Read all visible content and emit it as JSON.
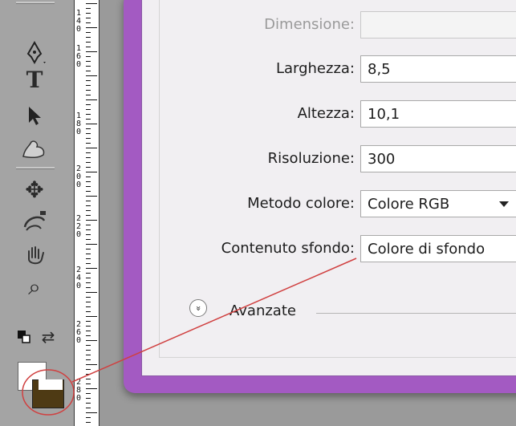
{
  "dialog": {
    "fields": [
      {
        "label": "Dimensione:",
        "value": ""
      },
      {
        "label": "Larghezza:",
        "value": "8,5"
      },
      {
        "label": "Altezza:",
        "value": "10,1"
      },
      {
        "label": "Risoluzione:",
        "value": "300"
      },
      {
        "label": "Metodo colore:",
        "value": "Colore RGB"
      },
      {
        "label": "Contenuto sfondo:",
        "value": "Colore di sfondo"
      }
    ],
    "advanced_label": "Avanzate",
    "advanced_toggle_glyph": "»"
  },
  "ruler": {
    "digits": [
      "1",
      "4",
      "0",
      "1",
      "6",
      "0",
      "1",
      "8",
      "0",
      "2",
      "0",
      "0",
      "2",
      "2",
      "0",
      "2",
      "4",
      "0",
      "2",
      "6",
      "0",
      "2",
      "8",
      "0"
    ]
  },
  "toolbar": {
    "tools": [
      "pen-tool-icon",
      "text-tool-icon",
      "path-selection-icon",
      "custom-shape-icon",
      "rotate-view-icon",
      "3d-orbit-icon",
      "hand-tool-icon",
      "zoom-tool-icon",
      "default-colors-icon",
      "swap-colors-icon"
    ],
    "type_tool_glyph": "T",
    "zoom_glyph": "⌕",
    "move_glyph": "✥",
    "swap_glyph": "⇄"
  },
  "colors": {
    "foreground": "#4e3a14",
    "background": "#ffffff",
    "dialog_frame": "#a35ac2",
    "annotation": "#d04040"
  }
}
